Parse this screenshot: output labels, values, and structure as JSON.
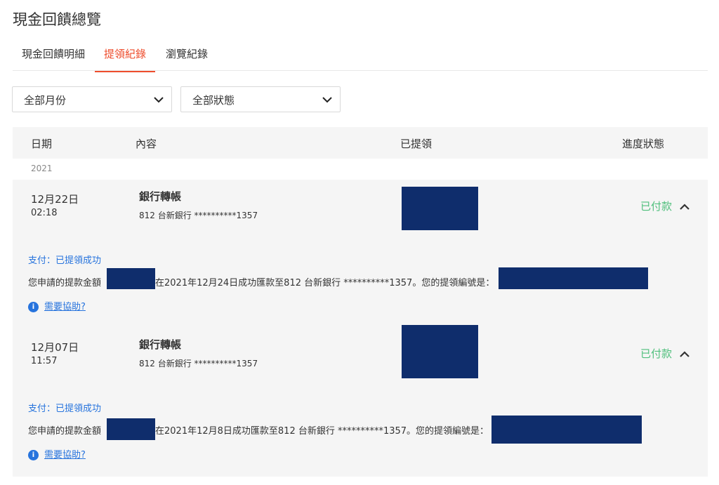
{
  "page": {
    "title": "現金回饋總覽"
  },
  "tabs": [
    {
      "label": "現金回饋明細"
    },
    {
      "label": "提領紀錄"
    },
    {
      "label": "瀏覽紀錄"
    }
  ],
  "filters": {
    "month": "全部月份",
    "status": "全部狀態"
  },
  "table": {
    "headers": [
      "日期",
      "內容",
      "已提領",
      "進度狀態"
    ],
    "year": "2021"
  },
  "records": [
    {
      "date": "12月22日",
      "time": "02:18",
      "title": "銀行轉帳",
      "account": "812 台新銀行 **********1357",
      "status": "已付款",
      "pay_label": "支付：已提領成功",
      "msg_prefix": "您申請的提款金額",
      "msg_body": "在2021年12月24日成功匯款至812 台新銀行 **********1357。您的提領編號是：",
      "help": "需要協助?"
    },
    {
      "date": "12月07日",
      "time": "11:57",
      "title": "銀行轉帳",
      "account": "812 台新銀行 **********1357",
      "status": "已付款",
      "pay_label": "支付：已提領成功",
      "msg_prefix": "您申請的提款金額",
      "msg_body": "在2021年12月8日成功匯款至812 台新銀行 **********1357。您的提領編號是：",
      "help": "需要協助?"
    }
  ],
  "colors": {
    "accent": "#ee4d2d",
    "success": "#4fbf7c",
    "link": "#2673dd",
    "redaction": "#0f2d6c"
  }
}
